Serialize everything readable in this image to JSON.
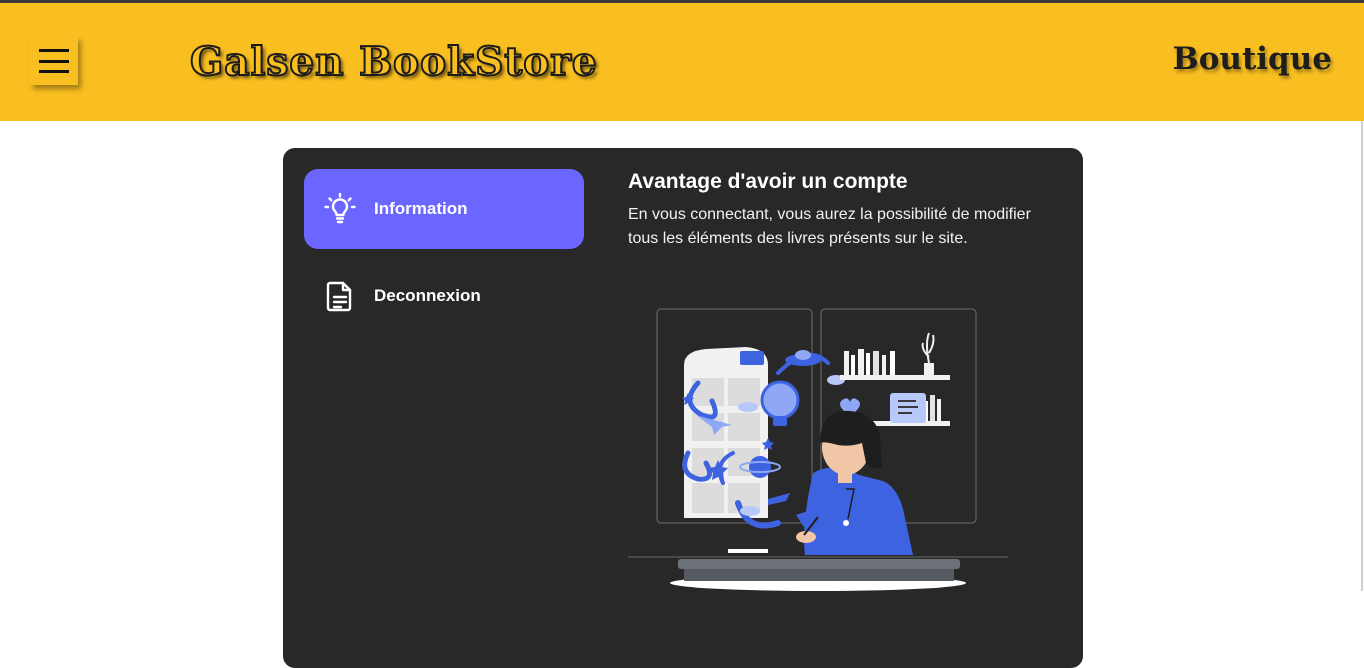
{
  "header": {
    "menu_icon": "hamburger-icon",
    "brand": "Galsen BookStore",
    "shop_link": "Boutique",
    "background_color": "#f9bf21"
  },
  "sidebar": {
    "items": [
      {
        "label": "Information",
        "icon": "lightbulb-icon",
        "active": true
      },
      {
        "label": "Deconnexion",
        "icon": "document-icon",
        "active": false
      }
    ],
    "active_color": "#6a66ff"
  },
  "main": {
    "title": "Avantage d'avoir un compte",
    "description": "En vous connectant, vous aurez la possibilité de modifier tous les éléments des livres présents sur le site.",
    "illustration": "woman-writing-books-illustration"
  },
  "colors": {
    "panel": "#282828",
    "accent": "#3d63e0"
  }
}
